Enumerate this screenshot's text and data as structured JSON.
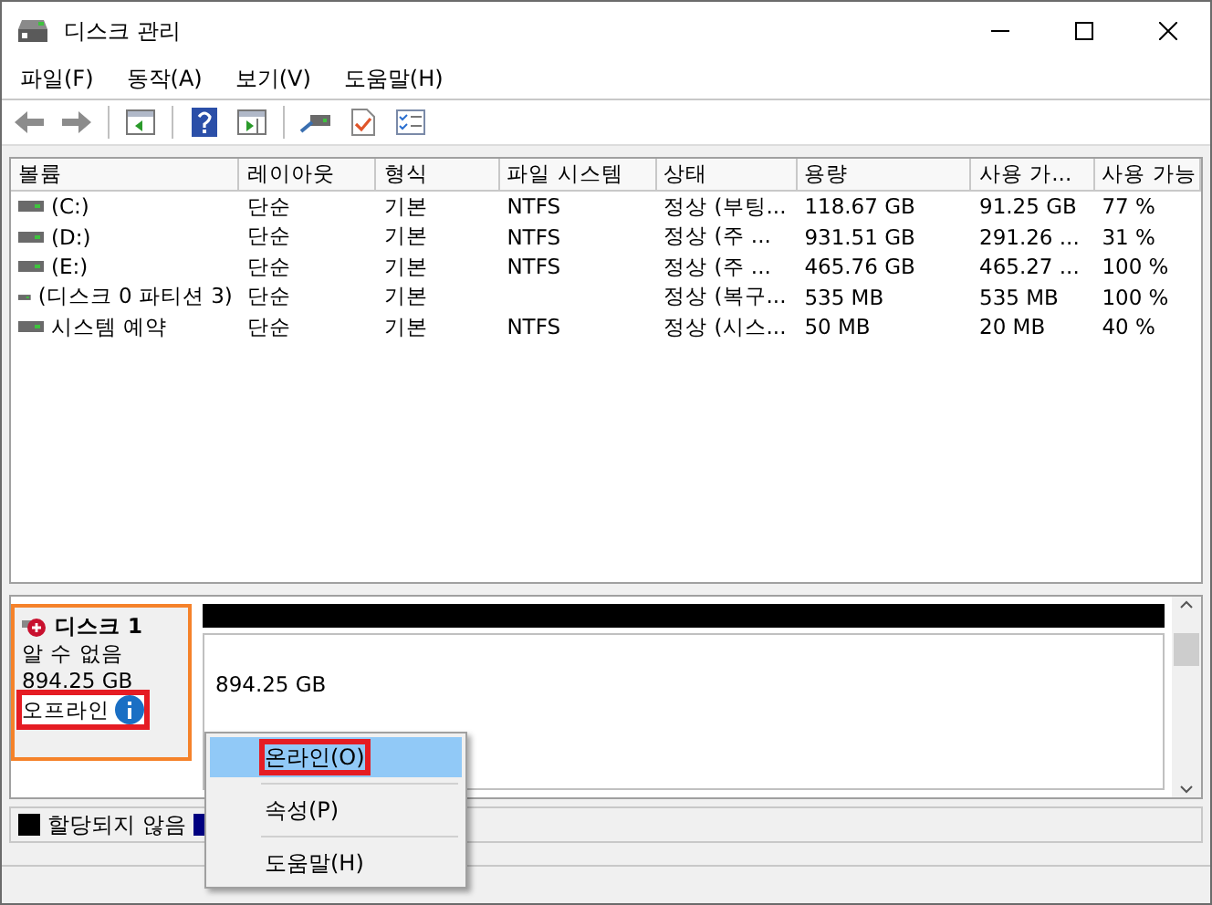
{
  "window": {
    "title": "디스크 관리"
  },
  "menu": [
    "파일(F)",
    "동작(A)",
    "보기(V)",
    "도움말(H)"
  ],
  "table": {
    "columns": [
      "볼륨",
      "레이아웃",
      "형식",
      "파일 시스템",
      "상태",
      "용량",
      "사용 가...",
      "사용 가능"
    ],
    "rows": [
      [
        "(C:)",
        "단순",
        "기본",
        "NTFS",
        "정상 (부팅...",
        "118.67 GB",
        "91.25 GB",
        "77 %"
      ],
      [
        "(D:)",
        "단순",
        "기본",
        "NTFS",
        "정상 (주 ...",
        "931.51 GB",
        "291.26 ...",
        "31 %"
      ],
      [
        "(E:)",
        "단순",
        "기본",
        "NTFS",
        "정상 (주 ...",
        "465.76 GB",
        "465.27 ...",
        "100 %"
      ],
      [
        "(디스크 0 파티션 3)",
        "단순",
        "기본",
        "",
        "정상 (복구...",
        "535 MB",
        "535 MB",
        "100 %"
      ],
      [
        "시스템 예약",
        "단순",
        "기본",
        "NTFS",
        "정상 (시스...",
        "50 MB",
        "20 MB",
        "40 %"
      ]
    ]
  },
  "disk": {
    "name": "디스크 1",
    "type": "알 수 없음",
    "size": "894.25 GB",
    "state": "오프라인",
    "partition_size": "894.25 GB"
  },
  "legend": [
    {
      "label": "할당되지 않음",
      "color": "#000000"
    },
    {
      "color": "#000080"
    }
  ],
  "context_menu": [
    {
      "label": "온라인(O)",
      "selected": true
    },
    {
      "label": "속성(P)",
      "selected": false
    },
    {
      "label": "도움말(H)",
      "selected": false
    }
  ]
}
